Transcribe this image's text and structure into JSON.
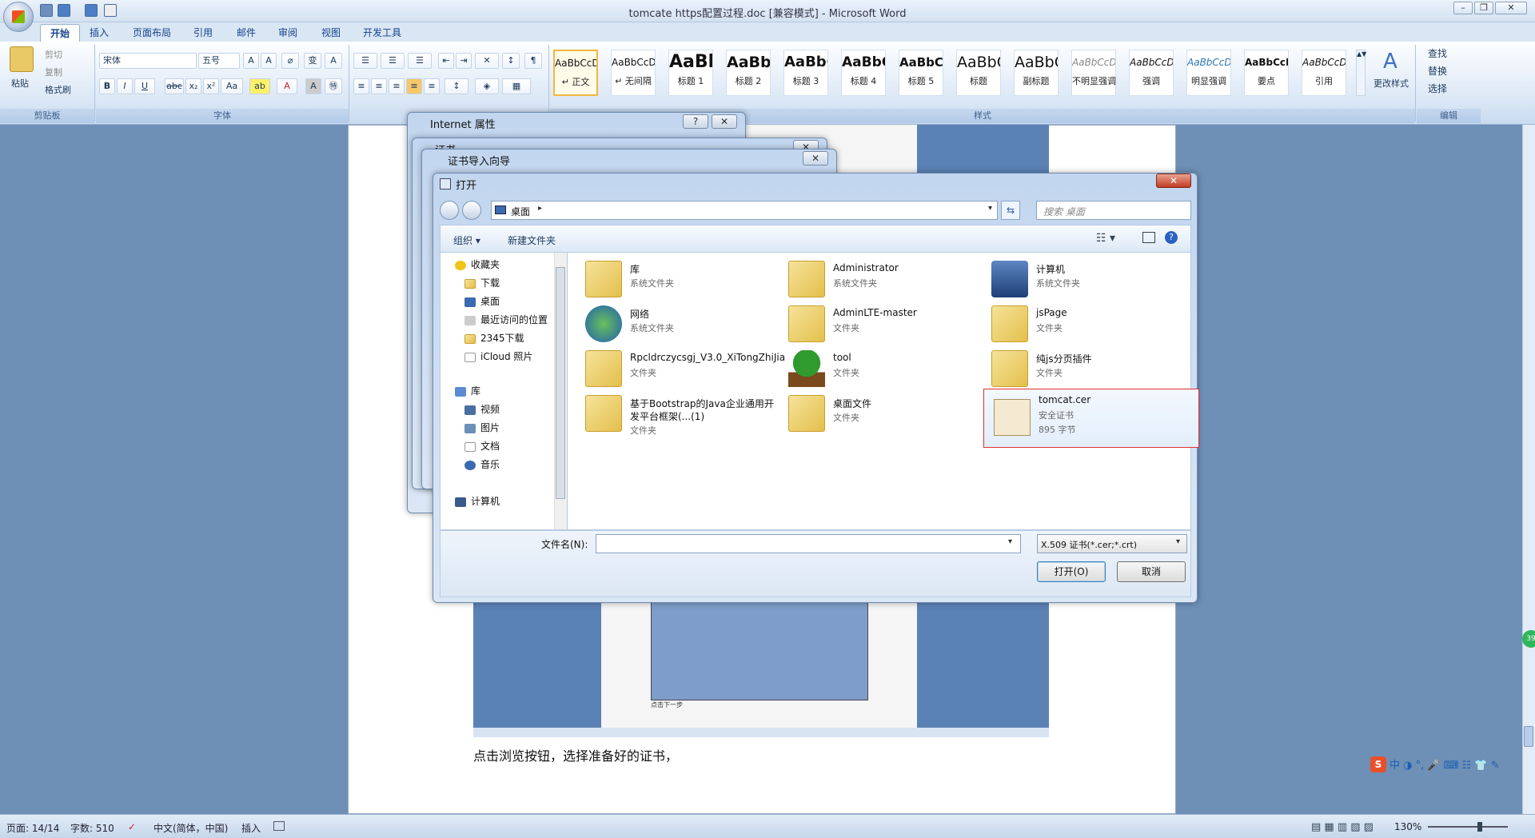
{
  "window": {
    "title": "tomcate https配置过程.doc [兼容模式] - Microsoft Word"
  },
  "tabs": [
    "开始",
    "插入",
    "页面布局",
    "引用",
    "邮件",
    "审阅",
    "视图",
    "开发工具"
  ],
  "ribbon": {
    "clipboard": {
      "paste": "粘贴",
      "cut": "剪切",
      "copy": "复制",
      "format_painter": "格式刷",
      "label": "剪贴板"
    },
    "font": {
      "name": "宋体",
      "size": "五号",
      "label": "字体"
    },
    "paragraph": {
      "label": "段落"
    },
    "styles": {
      "label": "样式",
      "items": [
        {
          "preview": "AaBbCcDd",
          "name": "↵ 正文"
        },
        {
          "preview": "AaBbCcDd",
          "name": "↵ 无间隔"
        },
        {
          "preview": "AaBb",
          "name": "标题 1"
        },
        {
          "preview": "AaBbC",
          "name": "标题 2"
        },
        {
          "preview": "AaBbC",
          "name": "标题 3"
        },
        {
          "preview": "AaBbC",
          "name": "标题 4"
        },
        {
          "preview": "AaBbCc",
          "name": "标题 5"
        },
        {
          "preview": "AaBbC",
          "name": "标题"
        },
        {
          "preview": "AaBbC",
          "name": "副标题"
        },
        {
          "preview": "AaBbCcDd",
          "name": "不明显强调"
        },
        {
          "preview": "AaBbCcDd",
          "name": "强调"
        },
        {
          "preview": "AaBbCcDd",
          "name": "明显强调"
        },
        {
          "preview": "AaBbCcDd",
          "name": "要点"
        },
        {
          "preview": "AaBbCcDd",
          "name": "引用"
        }
      ],
      "change_styles": "更改样式"
    },
    "editing": {
      "find": "查找",
      "replace": "替换",
      "select": "选择",
      "label": "编辑"
    }
  },
  "dialogs": {
    "internet_props": {
      "title": "Internet 属性"
    },
    "cert": {
      "title": "证书"
    },
    "cert_wizard": {
      "title": "证书导入向导"
    },
    "open": {
      "title": "打开",
      "address": "桌面",
      "search_placeholder": "搜索 桌面",
      "organize": "组织",
      "new_folder": "新建文件夹",
      "nav": {
        "favorites": "收藏夹",
        "favorites_items": [
          "下载",
          "桌面",
          "最近访问的位置",
          "2345下载",
          "iCloud 照片"
        ],
        "library": "库",
        "library_items": [
          "视频",
          "图片",
          "文档",
          "音乐"
        ],
        "computer": "计算机"
      },
      "files": [
        {
          "name": "库",
          "type": "系统文件夹"
        },
        {
          "name": "Administrator",
          "type": "系统文件夹"
        },
        {
          "name": "计算机",
          "type": "系统文件夹"
        },
        {
          "name": "网络",
          "type": "系统文件夹"
        },
        {
          "name": "AdminLTE-master",
          "type": "文件夹"
        },
        {
          "name": "jsPage",
          "type": "文件夹"
        },
        {
          "name": "Rpcldrczycsgj_V3.0_XiTongZhiJia",
          "type": "文件夹"
        },
        {
          "name": "tool",
          "type": "文件夹"
        },
        {
          "name": "纯js分页插件",
          "type": "文件夹"
        },
        {
          "name": "基于Bootstrap的Java企业通用开",
          "name2": "发平台框架(...(1)",
          "type": "文件夹"
        },
        {
          "name": "桌面文件",
          "type": "文件夹"
        },
        {
          "name": "tomcat.cer",
          "type": "安全证书",
          "size": "895 字节"
        }
      ],
      "filename_label": "文件名(N):",
      "filename_value": "",
      "filter": "X.509 证书(*.cer;*.crt)",
      "open_btn": "打开(O)",
      "cancel_btn": "取消"
    }
  },
  "document": {
    "caption": "点击浏览按钮，选择准备好的证书，",
    "inner_caption": "点击下一步"
  },
  "status": {
    "page": "页面: 14/14",
    "words": "字数: 510",
    "lang": "中文(简体，中国)",
    "mode": "插入",
    "zoom": "130%"
  },
  "colors": {
    "highlight_border": "#e03030",
    "accent": "#15428b"
  }
}
